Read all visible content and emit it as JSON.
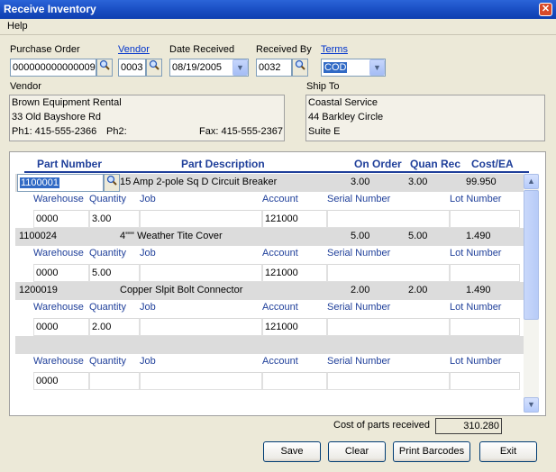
{
  "window": {
    "title": "Receive Inventory",
    "close_glyph": "✕"
  },
  "menu": {
    "help": "Help"
  },
  "header": {
    "po_label": "Purchase Order",
    "po_value": "000000000000009",
    "vendor_label": "Vendor",
    "vendor_value": "0003",
    "date_label": "Date Received",
    "date_value": "08/19/2005",
    "recv_label": "Received By",
    "recv_value": "0032",
    "terms_label": "Terms",
    "terms_value": "COD"
  },
  "vendor_box": {
    "label": "Vendor",
    "name": "Brown Equipment Rental",
    "address": "33 Old Bayshore Rd",
    "ph1": "Ph1: 415-555-2366",
    "ph2": "Ph2:",
    "fax": "Fax: 415-555-2367"
  },
  "shipto_box": {
    "label": "Ship To",
    "name": "Coastal Service",
    "address": "44 Barkley Circle",
    "suite": "Suite E"
  },
  "grid": {
    "headers": {
      "part_number": "Part Number",
      "part_description": "Part Description",
      "on_order": "On Order",
      "quan_rec": "Quan Rec",
      "cost_ea": "Cost/EA"
    },
    "sub_headers": {
      "warehouse": "Warehouse",
      "quantity": "Quantity",
      "job": "Job",
      "account": "Account",
      "serial": "Serial Number",
      "lot": "Lot Number"
    },
    "rows": [
      {
        "part": "1100001",
        "desc": "15 Amp 2-pole Sq D Circuit Breaker",
        "on_order": "3.00",
        "quan_rec": "3.00",
        "cost": "99.950",
        "warehouse": "0000",
        "quantity": "3.00",
        "job": "",
        "account": "121000",
        "serial": "",
        "lot": ""
      },
      {
        "part": "1100024",
        "desc": "4\"\"' Weather Tite Cover",
        "on_order": "5.00",
        "quan_rec": "5.00",
        "cost": "1.490",
        "warehouse": "0000",
        "quantity": "5.00",
        "job": "",
        "account": "121000",
        "serial": "",
        "lot": ""
      },
      {
        "part": "1200019",
        "desc": "Copper Slpit Bolt Connector",
        "on_order": "2.00",
        "quan_rec": "2.00",
        "cost": "1.490",
        "warehouse": "0000",
        "quantity": "2.00",
        "job": "",
        "account": "121000",
        "serial": "",
        "lot": ""
      },
      {
        "part": "",
        "desc": "",
        "on_order": "",
        "quan_rec": "",
        "cost": "",
        "warehouse": "0000",
        "quantity": "",
        "job": "",
        "account": "",
        "serial": "",
        "lot": ""
      }
    ]
  },
  "footer": {
    "cost_label": "Cost of parts received",
    "cost_value": "310.280"
  },
  "buttons": {
    "save": "Save",
    "clear": "Clear",
    "print": "Print Barcodes",
    "exit": "Exit"
  }
}
